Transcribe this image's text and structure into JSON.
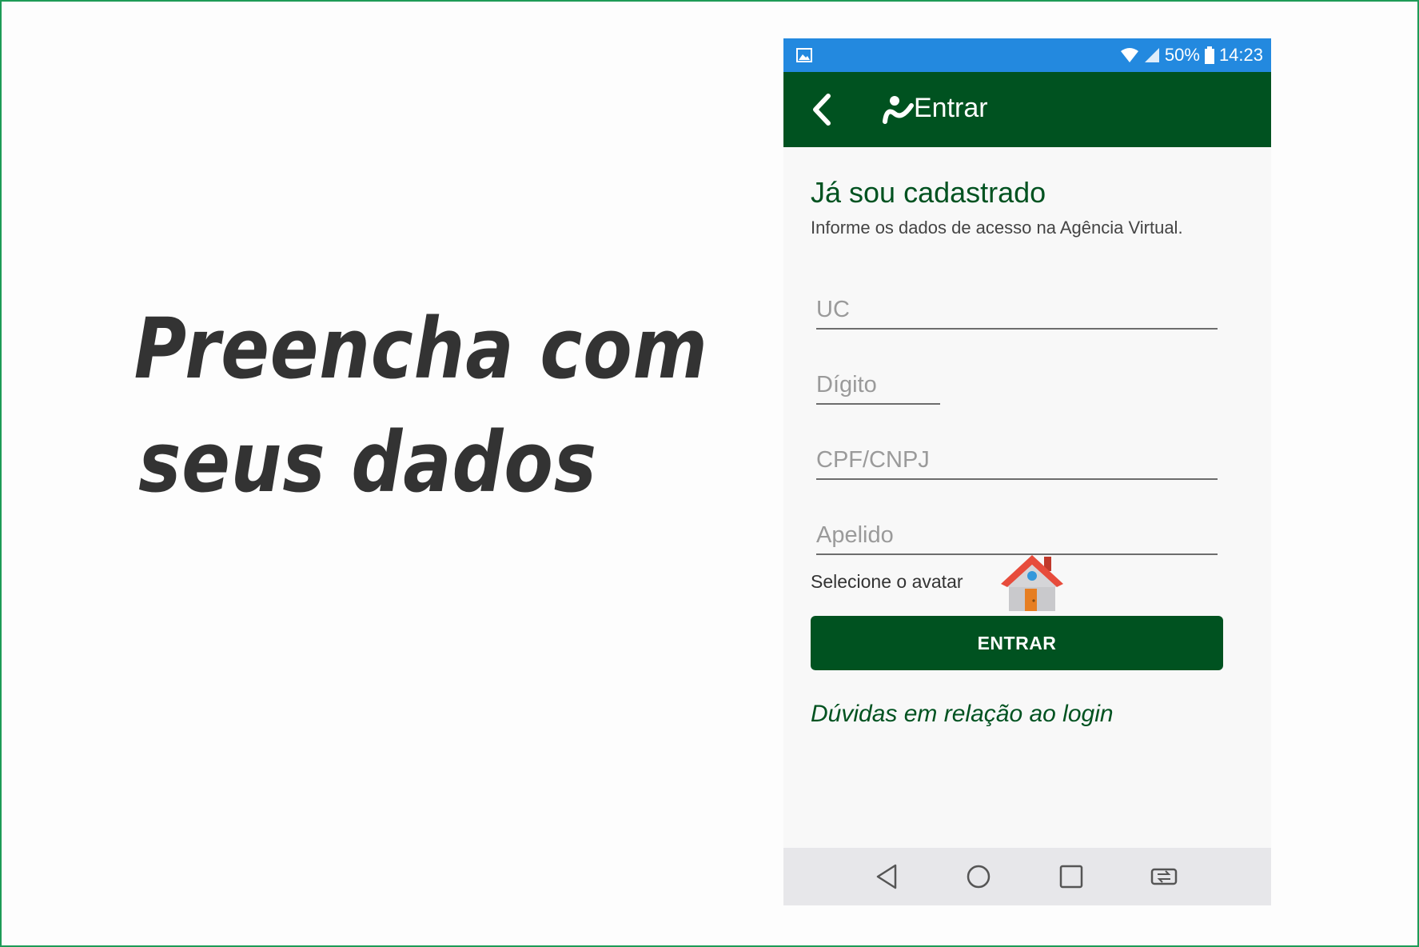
{
  "slide": {
    "headline_line1": "Preencha com",
    "headline_line2": "seus dados"
  },
  "statusbar": {
    "battery": "50%",
    "time": "14:23",
    "icons": [
      "gallery-icon",
      "wifi-icon",
      "signal-icon",
      "battery-icon"
    ]
  },
  "appbar": {
    "title": "Entrar",
    "back_icon": "back-arrow-icon",
    "logo_icon": "brand-logo-icon"
  },
  "form": {
    "heading": "Já sou cadastrado",
    "subheading": "Informe os dados de acesso na Agência Virtual.",
    "uc_placeholder": "UC",
    "digito_placeholder": "Dígito",
    "cpf_placeholder": "CPF/CNPJ",
    "apelido_placeholder": "Apelido",
    "avatar_label": "Selecione o avatar",
    "avatar_icon": "house-icon",
    "submit_label": "ENTRAR",
    "help_link": "Dúvidas em relação ao login"
  },
  "navbar": {
    "icons": [
      "nav-back-icon",
      "nav-home-icon",
      "nav-recents-icon",
      "nav-switch-icon"
    ]
  },
  "colors": {
    "brand_green": "#005220",
    "status_blue": "#2389df",
    "frame_green": "#1e9b57"
  }
}
